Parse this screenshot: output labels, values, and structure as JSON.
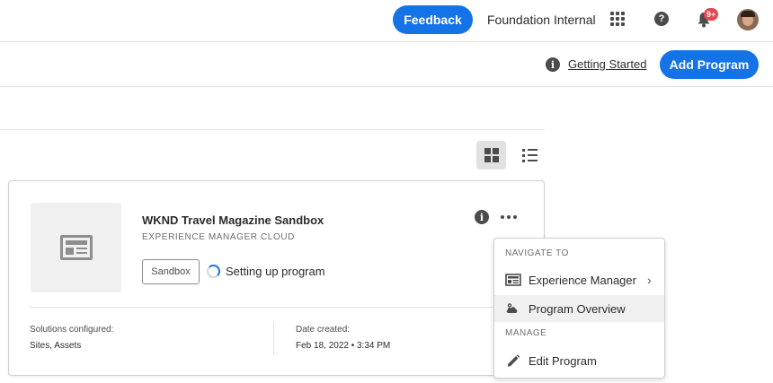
{
  "header": {
    "feedback_label": "Feedback",
    "org_name": "Foundation Internal",
    "notification_badge": "9+",
    "icons": [
      "apps-grid-icon",
      "help-icon",
      "bell-icon",
      "avatar"
    ]
  },
  "toolbar": {
    "getting_started_label": "Getting Started",
    "add_program_label": "Add Program"
  },
  "view_toggle": {
    "icons": [
      "grid-view-icon",
      "list-view-icon"
    ],
    "selected": "grid"
  },
  "program_card": {
    "title": "WKND Travel Magazine Sandbox",
    "subtitle": "EXPERIENCE MANAGER CLOUD",
    "tag": "Sandbox",
    "status": "Setting up program",
    "solutions_label": "Solutions configured:",
    "solutions_value": "Sites, Assets",
    "date_label": "Date created:",
    "date_value": "Feb 18, 2022 • 3:34 PM"
  },
  "context_menu": {
    "navigate_heading": "NAVIGATE TO",
    "items_navigate": [
      {
        "label": "Experience Manager",
        "icon": "experience-manager-icon",
        "has_submenu": true
      },
      {
        "label": "Program Overview",
        "icon": "cloud-gear-icon",
        "has_submenu": false
      }
    ],
    "manage_heading": "MANAGE",
    "items_manage": [
      {
        "label": "Edit Program",
        "icon": "pencil-icon"
      }
    ]
  },
  "colors": {
    "accent": "#1473e6",
    "badge": "#e34850",
    "icon_gray": "#4b4b4b"
  }
}
